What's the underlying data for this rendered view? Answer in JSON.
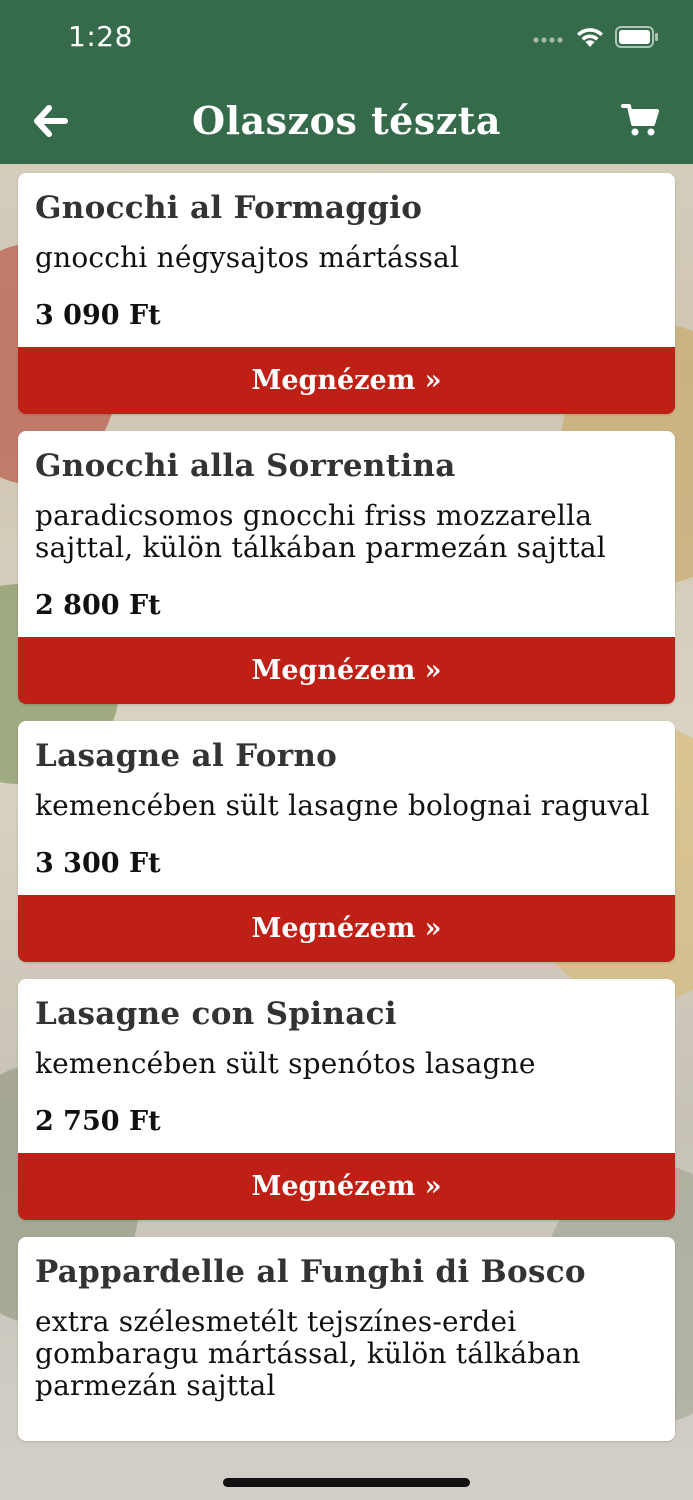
{
  "status_bar": {
    "time": "1:28"
  },
  "nav": {
    "title": "Olaszos tészta"
  },
  "products": [
    {
      "title": "Gnocchi al Formaggio",
      "description": "gnocchi négysajtos mártással",
      "price": "3 090 Ft",
      "button": "Megnézem »"
    },
    {
      "title": "Gnocchi alla Sorrentina",
      "description": "paradicsomos gnocchi friss mozzarella sajttal, külön tálkában parmezán sajttal",
      "price": "2 800 Ft",
      "button": "Megnézem »"
    },
    {
      "title": "Lasagne al Forno",
      "description": "kemencében sült lasagne bolognai raguval",
      "price": "3 300 Ft",
      "button": "Megnézem »"
    },
    {
      "title": "Lasagne con Spinaci",
      "description": "kemencében sült spenótos lasagne",
      "price": "2 750 Ft",
      "button": "Megnézem »"
    },
    {
      "title": "Pappardelle al Funghi di Bosco",
      "description": "extra szélesmetélt tejszínes-erdei gombaragu mártással, külön tálkában parmezán sajttal",
      "price": "",
      "button": ""
    }
  ],
  "colors": {
    "header": "#356b4a",
    "button": "#bf2016"
  },
  "icons": {
    "back": "arrow-left-icon",
    "cart": "cart-icon",
    "signal": "signal-icon",
    "wifi": "wifi-icon",
    "battery": "battery-icon"
  }
}
